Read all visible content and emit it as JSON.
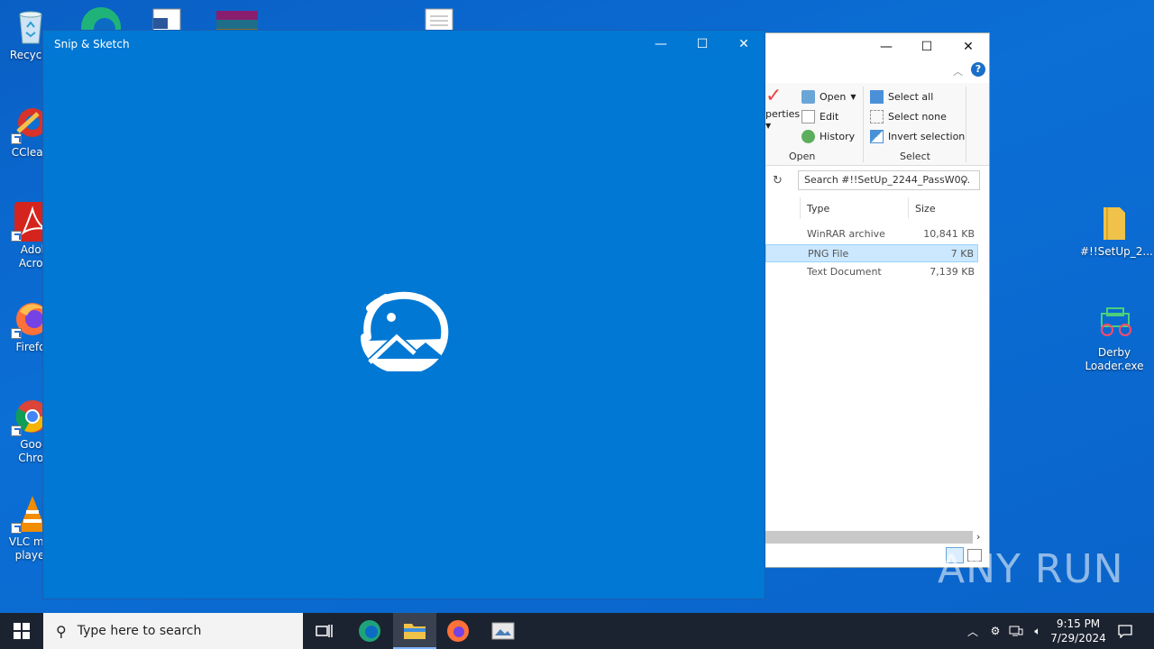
{
  "desktop": {
    "icons_left": [
      {
        "label": "Recycle",
        "icon": "recycle-bin-icon"
      },
      {
        "label": "CClean",
        "icon": "ccleaner-icon"
      },
      {
        "label": "Adob Acrob",
        "icon": "adobe-acrobat-icon"
      },
      {
        "label": "Firefo",
        "icon": "firefox-icon"
      },
      {
        "label": "Goog Chron",
        "icon": "chrome-icon"
      },
      {
        "label": "VLC me playe",
        "icon": "vlc-icon"
      }
    ],
    "icons_right": [
      {
        "label": "#!!SetUp_2...",
        "icon": "folder-icon"
      },
      {
        "label": "Derby Loader.exe",
        "icon": "derby-loader-icon"
      }
    ]
  },
  "explorer": {
    "ribbon": {
      "properties_label": "perties",
      "open_label": "Open",
      "edit_label": "Edit",
      "history_label": "History",
      "open_group": "Open",
      "select_all": "Select all",
      "select_none": "Select none",
      "invert_selection": "Invert selection",
      "select_group": "Select"
    },
    "search_placeholder": "Search #!!SetUp_2244_PassW0...",
    "columns": {
      "type": "Type",
      "size": "Size"
    },
    "rows": [
      {
        "type": "WinRAR archive",
        "size": "10,841 KB"
      },
      {
        "type": "PNG File",
        "size": "7 KB"
      },
      {
        "type": "Text Document",
        "size": "7,139 KB"
      }
    ]
  },
  "snip": {
    "title": "Snip & Sketch"
  },
  "watermark": "ANY RUN",
  "taskbar": {
    "search_placeholder": "Type here to search",
    "time": "9:15 PM",
    "date": "7/29/2024"
  },
  "colors": {
    "snip_bg": "#0078d4",
    "taskbar_bg": "#1c2330",
    "selection": "#cce8ff"
  }
}
